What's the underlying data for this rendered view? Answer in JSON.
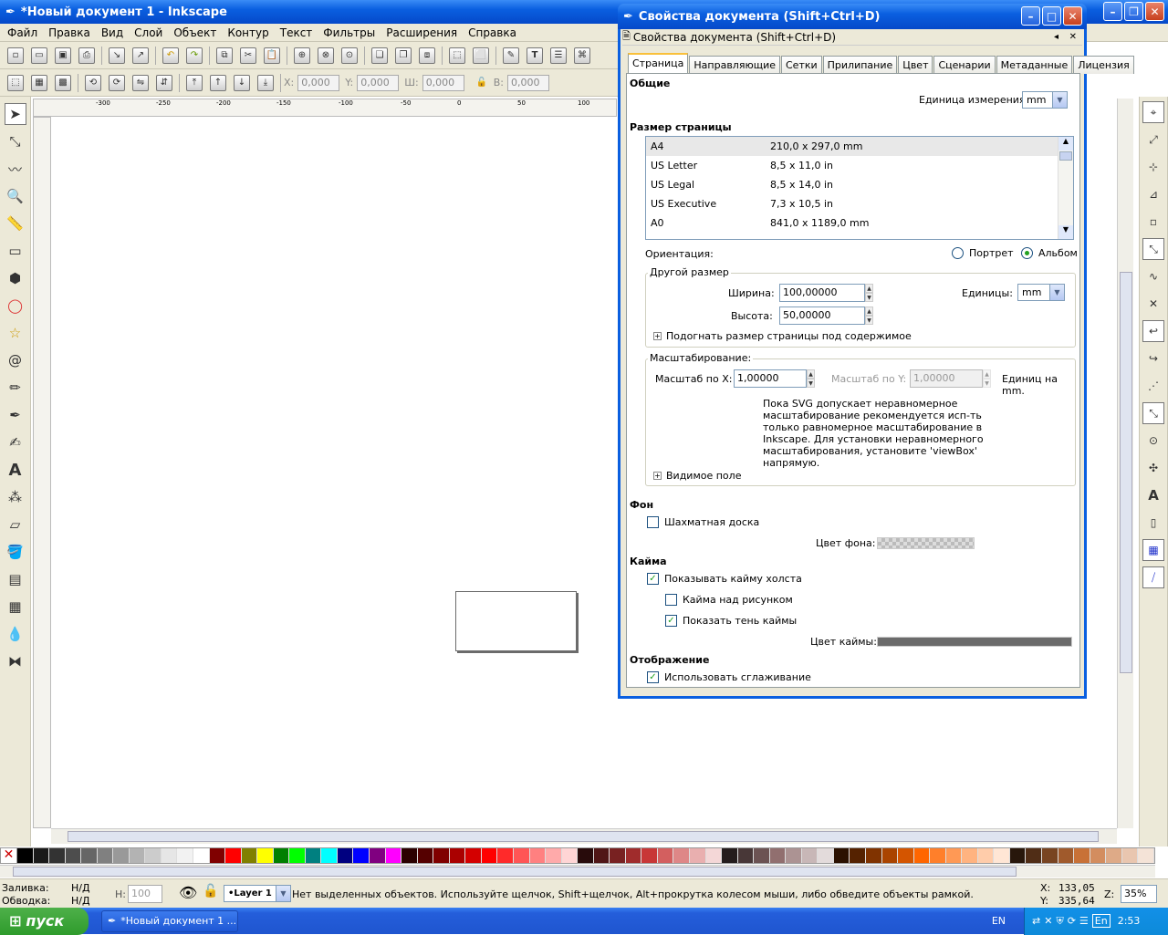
{
  "app": {
    "title": "*Новый документ 1 - Inkscape",
    "menu": [
      "Файл",
      "Правка",
      "Вид",
      "Слой",
      "Объект",
      "Контур",
      "Текст",
      "Фильтры",
      "Расширения",
      "Справка"
    ],
    "coords": {
      "x_label": "X:",
      "x": "0,000",
      "y_label": "Y:",
      "y": "0,000",
      "w_label": "Ш:",
      "w": "0,000",
      "h_label": "В:",
      "h": "0,000"
    },
    "ruler_ticks": [
      "-300",
      "-250",
      "-200",
      "-150",
      "-100",
      "-50",
      "0",
      "50",
      "100"
    ],
    "status": {
      "fill_label": "Заливка:",
      "fill_value": "Н/Д",
      "stroke_label": "Обводка:",
      "stroke_value": "Н/Д",
      "h_label": "H:",
      "h_value": "100",
      "layer": "•Layer 1",
      "message": "Нет выделенных объектов. Используйте щелчок, Shift+щелчок, Alt+прокрутка колесом мыши, либо обведите объекты рамкой.",
      "x_label": "X:",
      "x": "133,05",
      "y_label": "Y:",
      "y": "335,64",
      "z_label": "Z:",
      "zoom": "35%"
    }
  },
  "dialog": {
    "title": "Свойства документа (Shift+Ctrl+D)",
    "subtitle": "Свойства документа (Shift+Ctrl+D)",
    "tabs": [
      "Страница",
      "Направляющие",
      "Сетки",
      "Прилипание",
      "Цвет",
      "Сценарии",
      "Метаданные",
      "Лицензия"
    ],
    "general": {
      "heading": "Общие",
      "unit_label": "Единица измерения:",
      "unit": "mm"
    },
    "page_size": {
      "heading": "Размер страницы",
      "items": [
        {
          "name": "A4",
          "size": "210,0 x 297,0 mm"
        },
        {
          "name": "US Letter",
          "size": "8,5 x 11,0 in"
        },
        {
          "name": "US Legal",
          "size": "8,5 x 14,0 in"
        },
        {
          "name": "US Executive",
          "size": "7,3 x 10,5 in"
        },
        {
          "name": "A0",
          "size": "841,0 x 1189,0 mm"
        }
      ]
    },
    "orientation": {
      "label": "Ориентация:",
      "portrait": "Портрет",
      "landscape": "Альбом"
    },
    "custom": {
      "title": "Другой размер",
      "width_label": "Ширина:",
      "width": "100,00000",
      "height_label": "Высота:",
      "height": "50,00000",
      "units_label": "Единицы:",
      "units": "mm",
      "fit": "Подогнать размер страницы под содержимое"
    },
    "scale": {
      "title": "Масштабирование:",
      "x_label": "Масштаб по X:",
      "x": "1,00000",
      "y_label": "Масштаб по Y:",
      "y": "1,00000",
      "units": "Единиц на mm.",
      "note": [
        "Пока SVG допускает неравномерное",
        "масштабирование рекомендуется исп-ть",
        "только равномерное масштабирование в",
        "Inkscape. Для установки неравномерного",
        "масштабирования, установите 'viewBox'",
        "напрямую."
      ],
      "viewbox": "Видимое поле"
    },
    "background": {
      "heading": "Фон",
      "checker": "Шахматная доска",
      "color_label": "Цвет фона:"
    },
    "border": {
      "heading": "Кайма",
      "show": "Показывать кайму холста",
      "on_top": "Кайма над рисунком",
      "shadow": "Показать тень каймы",
      "color_label": "Цвет каймы:",
      "color": "#6b6b6b"
    },
    "display": {
      "heading": "Отображение",
      "antialias": "Использовать сглаживание"
    }
  },
  "taskbar": {
    "start": "пуск",
    "task": "*Новый документ 1 ...",
    "lang": "EN",
    "lang2": "En",
    "time": "2:53"
  },
  "palette": [
    "#000000",
    "#1a1a1a",
    "#333333",
    "#4d4d4d",
    "#666666",
    "#808080",
    "#999999",
    "#b3b3b3",
    "#cccccc",
    "#e6e6e6",
    "#f2f2f2",
    "#ffffff",
    "#800000",
    "#ff0000",
    "#808000",
    "#ffff00",
    "#008000",
    "#00ff00",
    "#008080",
    "#00ffff",
    "#000080",
    "#0000ff",
    "#800080",
    "#ff00ff",
    "#2b0000",
    "#550000",
    "#800000",
    "#aa0000",
    "#d40000",
    "#ff0000",
    "#ff2a2a",
    "#ff5555",
    "#ff8080",
    "#ffaaaa",
    "#ffd5d5",
    "#280b0b",
    "#501616",
    "#782121",
    "#a02c2c",
    "#c83737",
    "#d35f5f",
    "#de8787",
    "#e9afaf",
    "#f4d7d7",
    "#241c1c",
    "#483737",
    "#6c5353",
    "#916f6f",
    "#ac9393",
    "#c8b7b7",
    "#e3dbdb",
    "#2b1100",
    "#552200",
    "#803300",
    "#aa4400",
    "#d45500",
    "#ff6600",
    "#ff7f2a",
    "#ff9955",
    "#ffb380",
    "#ffccaa",
    "#ffe6d5",
    "#28170b",
    "#502d16",
    "#784421",
    "#a05a2c",
    "#c87137",
    "#d38d5f",
    "#deaa87",
    "#e9c6af",
    "#f4e3d7"
  ]
}
